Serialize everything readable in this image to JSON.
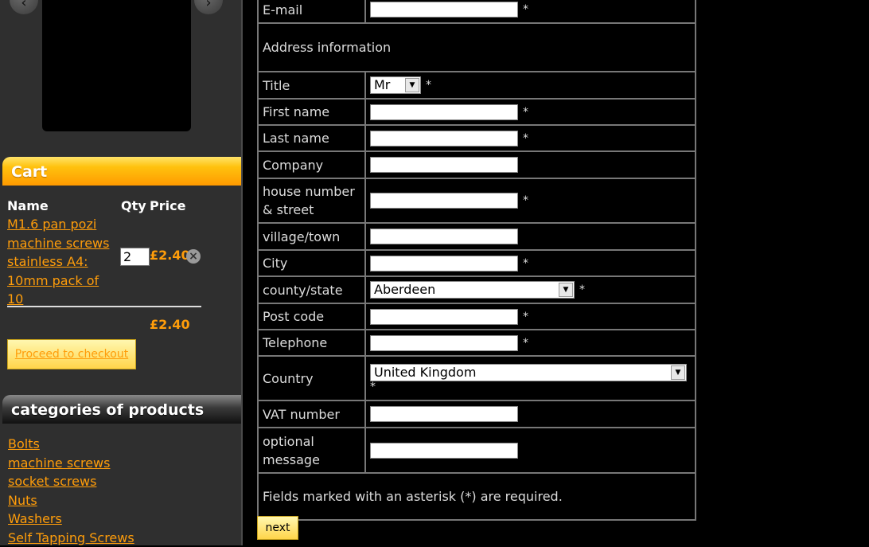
{
  "cart": {
    "title": "Cart",
    "col_name": "Name",
    "col_qty": "Qty",
    "col_price": "Price",
    "item": {
      "name": "M1.6 pan pozi machine screws stainless A4: 10mm pack of 10",
      "qty": "2",
      "price": "£2.40"
    },
    "total": "£2.40",
    "checkout_label": "Proceed to checkout"
  },
  "categories": {
    "title": "categories of products",
    "items": [
      "Bolts",
      "machine screws",
      "socket screws",
      "Nuts",
      "Washers",
      "Self Tapping Screws"
    ]
  },
  "form": {
    "email_label": "E-mail",
    "address_section": "Address information",
    "title_label": "Title",
    "title_value": "Mr",
    "first_name_label": "First name",
    "last_name_label": "Last name",
    "company_label": "Company",
    "street_label": "house number & street",
    "village_label": "village/town",
    "city_label": "City",
    "county_label": "county/state",
    "county_value": "Aberdeen",
    "postcode_label": "Post code",
    "telephone_label": "Telephone",
    "country_label": "Country",
    "country_value": "United Kingdom",
    "vat_label": "VAT number",
    "message_label": "optional message",
    "required_note": "Fields marked with an asterisk (*) are required.",
    "asterisk": "*",
    "next_label": "next"
  },
  "colors": {
    "link": "#ff9d0a",
    "cart_header": "#ffc20e",
    "background": "#000000",
    "sidebar": "#2f2f2f"
  },
  "icons": {
    "prev": "chevron-left-icon",
    "next": "chevron-right-icon",
    "remove": "remove-icon",
    "dropdown": "chevron-down-icon"
  }
}
